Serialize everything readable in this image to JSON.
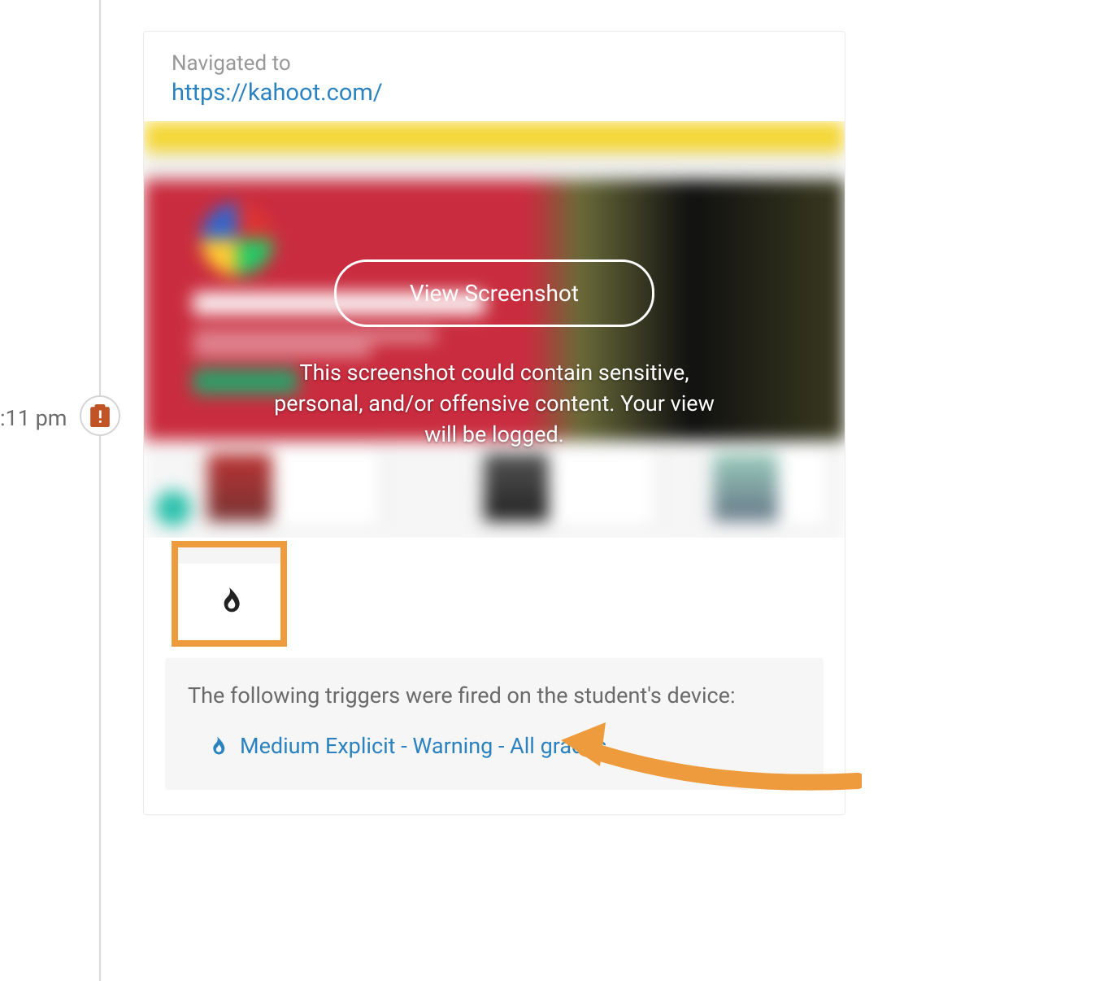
{
  "timeline": {
    "timestamp": ":11 pm"
  },
  "card": {
    "nav_label": "Navigated to",
    "nav_url": "https://kahoot.com/",
    "overlay": {
      "button_label": "View Screenshot",
      "warning_text": "This screenshot could contain sensitive, personal, and/or offensive content. Your view will be logged."
    },
    "triggers": {
      "heading": "The following triggers were fired on the student's device:",
      "items": [
        {
          "label": "Medium Explicit - Warning - All grades",
          "icon": "flame"
        }
      ]
    }
  },
  "colors": {
    "link": "#2a82c0",
    "highlight": "#ed9b3c",
    "badge": "#c15426"
  }
}
